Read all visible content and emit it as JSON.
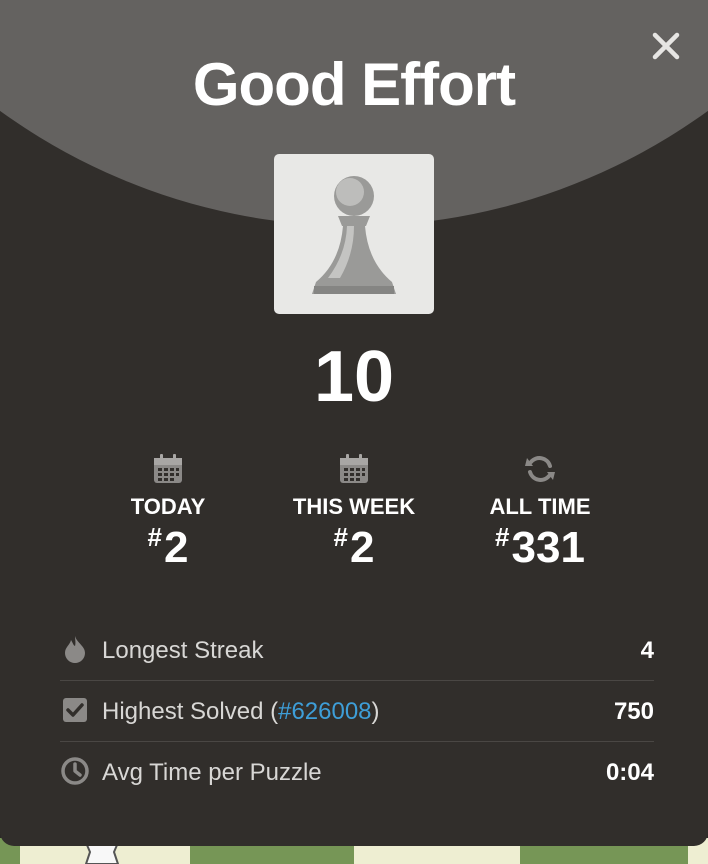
{
  "modal": {
    "title": "Good Effort",
    "score": "10",
    "close_icon": "close-icon",
    "pawn_icon": "pawn-icon"
  },
  "ranks": [
    {
      "icon": "calendar-icon",
      "label": "TODAY",
      "hash": "#",
      "value": "2"
    },
    {
      "icon": "calendar-icon",
      "label": "THIS WEEK",
      "hash": "#",
      "value": "2"
    },
    {
      "icon": "refresh-icon",
      "label": "ALL TIME",
      "hash": "#",
      "value": "331"
    }
  ],
  "stats": [
    {
      "icon": "flame-icon",
      "label": "Longest Streak",
      "value": "4"
    },
    {
      "icon": "checkbox-icon",
      "label_prefix": "Highest Solved (",
      "link": "#626008",
      "label_suffix": ")",
      "value": "750"
    },
    {
      "icon": "clock-icon",
      "label": "Avg Time per Puzzle",
      "value": "0:04"
    }
  ],
  "colors": {
    "modal_bg": "#312e2b",
    "arc": "#646260",
    "link": "#3e9ed8",
    "board_green": "#769656"
  }
}
